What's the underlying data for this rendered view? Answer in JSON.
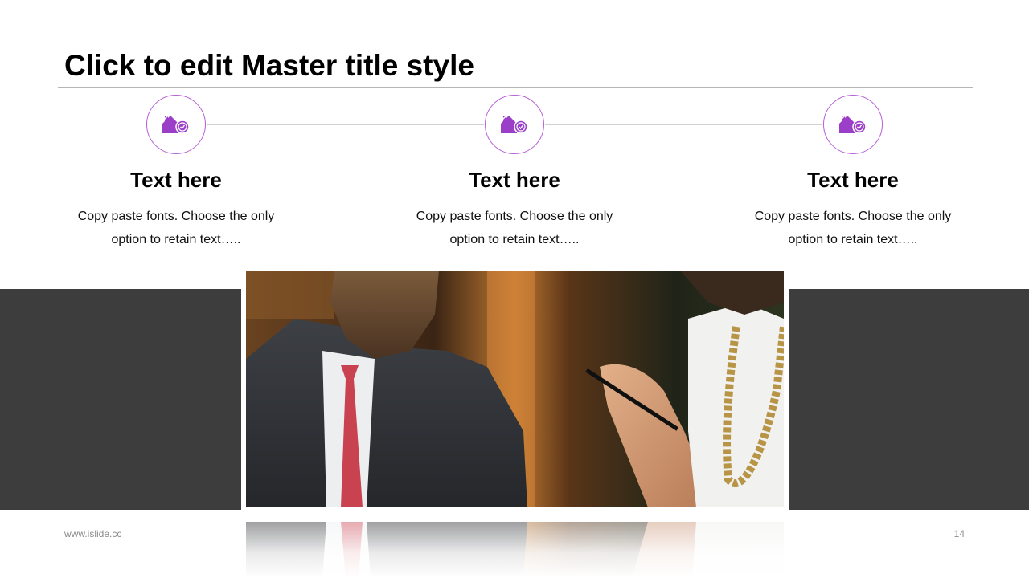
{
  "slide": {
    "title": "Click to edit Master title style",
    "footer_left": "www.islide.cc",
    "page_number": "14"
  },
  "steps": [
    {
      "icon": "house-badge-icon",
      "heading": "Text here",
      "description": "Copy paste fonts. Choose the only option to retain text….."
    },
    {
      "icon": "house-badge-icon",
      "heading": "Text here",
      "description": "Copy paste fonts. Choose the only option to retain text….."
    },
    {
      "icon": "house-badge-icon",
      "heading": "Text here",
      "description": "Copy paste fonts. Choose the only option to retain text….."
    }
  ],
  "colors": {
    "accent": "#9b3fc9",
    "circle_border": "#b75fd6",
    "band": "#3d3d3d",
    "footer_text": "#8a8a8a"
  },
  "image": {
    "subject": "business-meeting-photo"
  }
}
